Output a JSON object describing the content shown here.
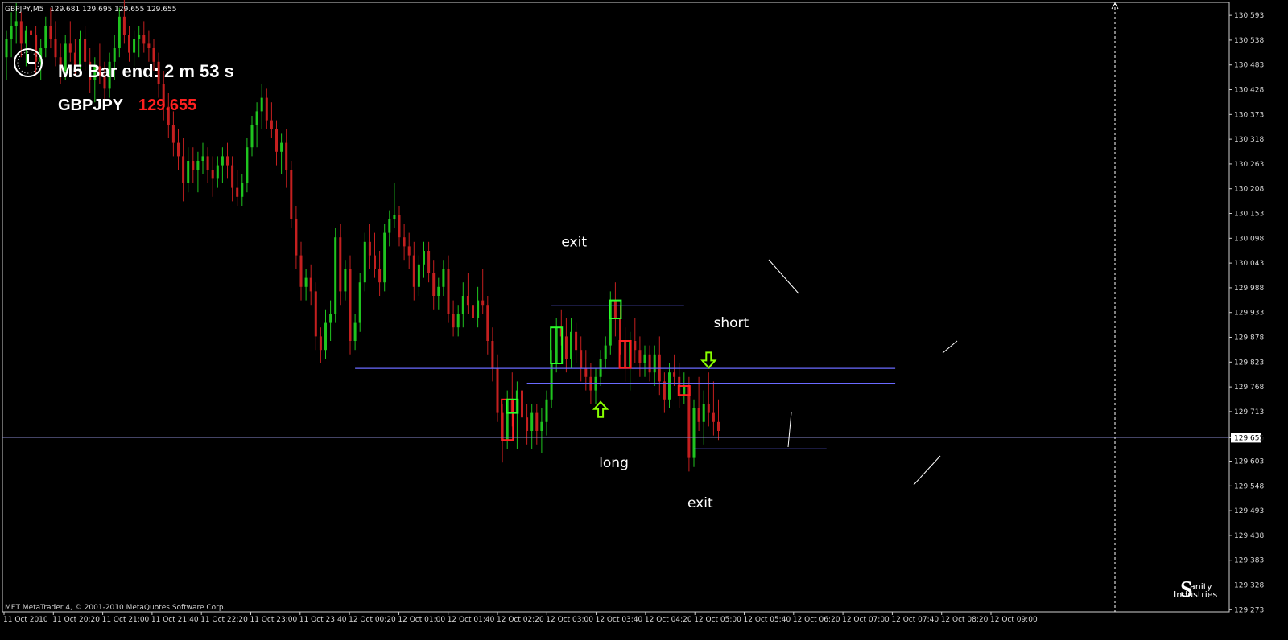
{
  "header": {
    "symbol_timeframe": "GBPJPY,M5",
    "ohlc": "129.681 129.695 129.655 129.655"
  },
  "timer": {
    "label": "M5 Bar end: 2 m 53 s",
    "icon": "clock-icon"
  },
  "quote": {
    "symbol": "GBPJPY",
    "price": "129.655"
  },
  "footer": {
    "copyright": "MET MetaTrader 4, © 2001-2010 MetaQuotes Software Corp.",
    "logo_line1": "anity",
    "logo_line2": "Industries",
    "logo_glyph": "S"
  },
  "colors": {
    "background": "#000000",
    "bull": "#1fc41f",
    "bear": "#c41f1f",
    "level_line": "#6a6aff",
    "highlight_bull": "#2bff2b",
    "highlight_bear": "#ff2020",
    "arrow": "#88ff00",
    "current_price_line": "#8888cc",
    "price_text": "#ff2020"
  },
  "chart_data": {
    "type": "candlestick",
    "title": "GBPJPY,M5",
    "timeframe": "M5",
    "ylim": [
      129.27,
      130.62
    ],
    "y_ticks": [
      "130.593",
      "130.538",
      "130.483",
      "130.428",
      "130.373",
      "130.318",
      "130.263",
      "130.208",
      "130.153",
      "130.098",
      "130.043",
      "129.988",
      "129.933",
      "129.878",
      "129.823",
      "129.768",
      "129.713",
      "129.655",
      "129.603",
      "129.548",
      "129.493",
      "129.438",
      "129.383",
      "129.328",
      "129.273"
    ],
    "x_ticks": [
      "11 Oct 2010",
      "11 Oct 20:20",
      "11 Oct 21:00",
      "11 Oct 21:40",
      "11 Oct 22:20",
      "11 Oct 23:00",
      "11 Oct 23:40",
      "12 Oct 00:20",
      "12 Oct 01:00",
      "12 Oct 01:40",
      "12 Oct 02:20",
      "12 Oct 03:00",
      "12 Oct 03:40",
      "12 Oct 04:20",
      "12 Oct 05:00",
      "12 Oct 05:40",
      "12 Oct 06:20",
      "12 Oct 07:00",
      "12 Oct 07:40",
      "12 Oct 08:20",
      "12 Oct 09:00"
    ],
    "current_price": 129.655,
    "grid": false,
    "candles": [
      [
        130.5,
        130.56,
        130.45,
        130.54
      ],
      [
        130.54,
        130.6,
        130.5,
        130.57
      ],
      [
        130.57,
        130.62,
        130.53,
        130.58
      ],
      [
        130.58,
        130.6,
        130.5,
        130.53
      ],
      [
        130.53,
        130.57,
        130.48,
        130.56
      ],
      [
        130.56,
        130.6,
        130.52,
        130.55
      ],
      [
        130.55,
        130.57,
        130.46,
        130.49
      ],
      [
        130.49,
        130.54,
        130.45,
        130.52
      ],
      [
        130.52,
        130.59,
        130.5,
        130.57
      ],
      [
        130.57,
        130.61,
        130.52,
        130.54
      ],
      [
        130.54,
        130.58,
        130.48,
        130.5
      ],
      [
        130.5,
        130.53,
        130.44,
        130.47
      ],
      [
        130.47,
        130.55,
        130.45,
        130.53
      ],
      [
        130.53,
        130.58,
        130.49,
        130.51
      ],
      [
        130.51,
        130.54,
        130.46,
        130.48
      ],
      [
        130.48,
        130.56,
        130.46,
        130.54
      ],
      [
        130.54,
        130.57,
        130.47,
        130.49
      ],
      [
        130.49,
        130.52,
        130.42,
        130.45
      ],
      [
        130.45,
        130.5,
        130.4,
        130.48
      ],
      [
        130.48,
        130.53,
        130.44,
        130.46
      ],
      [
        130.46,
        130.49,
        130.4,
        130.43
      ],
      [
        130.43,
        130.51,
        130.41,
        130.49
      ],
      [
        130.49,
        130.55,
        130.45,
        130.52
      ],
      [
        130.52,
        130.61,
        130.5,
        130.59
      ],
      [
        130.59,
        130.63,
        130.53,
        130.55
      ],
      [
        130.55,
        130.57,
        130.49,
        130.51
      ],
      [
        130.51,
        130.56,
        130.48,
        130.54
      ],
      [
        130.54,
        130.57,
        130.5,
        130.55
      ],
      [
        130.55,
        130.58,
        130.51,
        130.53
      ],
      [
        130.53,
        130.56,
        130.49,
        130.52
      ],
      [
        130.52,
        130.54,
        130.47,
        130.49
      ],
      [
        130.49,
        130.51,
        130.41,
        130.44
      ],
      [
        130.44,
        130.47,
        130.36,
        130.39
      ],
      [
        130.39,
        130.42,
        130.32,
        130.35
      ],
      [
        130.35,
        130.38,
        130.28,
        130.31
      ],
      [
        130.31,
        130.34,
        130.25,
        130.28
      ],
      [
        130.28,
        130.32,
        130.18,
        130.22
      ],
      [
        130.22,
        130.3,
        130.2,
        130.27
      ],
      [
        130.27,
        130.3,
        130.22,
        130.25
      ],
      [
        130.25,
        130.29,
        130.2,
        130.27
      ],
      [
        130.27,
        130.31,
        130.24,
        130.28
      ],
      [
        130.28,
        130.3,
        130.22,
        130.25
      ],
      [
        130.25,
        130.28,
        130.19,
        130.23
      ],
      [
        130.23,
        130.28,
        130.21,
        130.26
      ],
      [
        130.26,
        130.3,
        130.22,
        130.28
      ],
      [
        130.28,
        130.31,
        130.23,
        130.26
      ],
      [
        130.26,
        130.28,
        130.18,
        130.21
      ],
      [
        130.21,
        130.25,
        130.17,
        130.19
      ],
      [
        130.19,
        130.24,
        130.17,
        130.22
      ],
      [
        130.22,
        130.32,
        130.2,
        130.3
      ],
      [
        130.3,
        130.37,
        130.28,
        130.35
      ],
      [
        130.35,
        130.4,
        130.3,
        130.38
      ],
      [
        130.38,
        130.44,
        130.34,
        130.41
      ],
      [
        130.41,
        130.43,
        130.34,
        130.36
      ],
      [
        130.36,
        130.4,
        130.32,
        130.34
      ],
      [
        130.34,
        130.36,
        130.26,
        130.29
      ],
      [
        130.29,
        130.33,
        130.24,
        130.31
      ],
      [
        130.31,
        130.34,
        130.21,
        130.25
      ],
      [
        130.25,
        130.27,
        130.12,
        130.14
      ],
      [
        130.14,
        130.17,
        130.03,
        130.06
      ],
      [
        130.06,
        130.09,
        129.96,
        129.99
      ],
      [
        129.99,
        130.03,
        129.96,
        130.01
      ],
      [
        130.01,
        130.04,
        129.95,
        129.98
      ],
      [
        129.98,
        130.0,
        129.85,
        129.88
      ],
      [
        129.88,
        129.9,
        129.82,
        129.85
      ],
      [
        129.85,
        129.94,
        129.83,
        129.91
      ],
      [
        129.91,
        129.96,
        129.87,
        129.93
      ],
      [
        129.93,
        130.12,
        129.91,
        130.1
      ],
      [
        130.1,
        130.13,
        129.95,
        129.98
      ],
      [
        129.98,
        130.05,
        129.96,
        130.03
      ],
      [
        130.03,
        130.06,
        129.84,
        129.87
      ],
      [
        129.87,
        129.93,
        129.85,
        129.91
      ],
      [
        129.91,
        130.02,
        129.89,
        130.0
      ],
      [
        130.0,
        130.11,
        129.98,
        130.09
      ],
      [
        130.09,
        130.13,
        130.03,
        130.06
      ],
      [
        130.06,
        130.11,
        130.01,
        130.03
      ],
      [
        130.03,
        130.07,
        129.97,
        130.0
      ],
      [
        130.0,
        130.13,
        129.98,
        130.11
      ],
      [
        130.11,
        130.16,
        130.08,
        130.14
      ],
      [
        130.14,
        130.22,
        130.12,
        130.15
      ],
      [
        130.15,
        130.17,
        130.08,
        130.1
      ],
      [
        130.1,
        130.13,
        130.05,
        130.08
      ],
      [
        130.08,
        130.11,
        130.03,
        130.06
      ],
      [
        130.06,
        130.09,
        129.96,
        129.99
      ],
      [
        129.99,
        130.06,
        129.97,
        130.04
      ],
      [
        130.04,
        130.09,
        130.01,
        130.07
      ],
      [
        130.07,
        130.09,
        130.0,
        130.02
      ],
      [
        130.02,
        130.05,
        129.94,
        129.97
      ],
      [
        129.97,
        130.01,
        129.94,
        129.99
      ],
      [
        129.99,
        130.05,
        129.97,
        130.03
      ],
      [
        130.03,
        130.06,
        129.91,
        129.93
      ],
      [
        129.93,
        129.96,
        129.88,
        129.9
      ],
      [
        129.9,
        129.95,
        129.88,
        129.93
      ],
      [
        129.93,
        130.0,
        129.9,
        129.97
      ],
      [
        129.97,
        130.02,
        129.93,
        129.95
      ],
      [
        129.95,
        129.98,
        129.89,
        129.92
      ],
      [
        129.92,
        129.99,
        129.9,
        129.96
      ],
      [
        129.96,
        130.03,
        129.93,
        129.95
      ],
      [
        129.95,
        129.97,
        129.84,
        129.87
      ],
      [
        129.87,
        129.9,
        129.78,
        129.81
      ],
      [
        129.81,
        129.84,
        129.69,
        129.71
      ],
      [
        129.71,
        129.73,
        129.6,
        129.65
      ],
      [
        129.65,
        129.76,
        129.63,
        129.74
      ],
      [
        129.74,
        129.8,
        129.68,
        129.71
      ],
      [
        129.71,
        129.78,
        129.63,
        129.76
      ],
      [
        129.76,
        129.79,
        129.66,
        129.7
      ],
      [
        129.7,
        129.73,
        129.64,
        129.67
      ],
      [
        129.67,
        129.73,
        129.63,
        129.71
      ],
      [
        129.71,
        129.73,
        129.64,
        129.67
      ],
      [
        129.67,
        129.72,
        129.62,
        129.69
      ],
      [
        129.69,
        129.76,
        129.66,
        129.74
      ],
      [
        129.74,
        129.85,
        129.72,
        129.82
      ],
      [
        129.82,
        129.92,
        129.8,
        129.9
      ],
      [
        129.9,
        129.94,
        129.86,
        129.88
      ],
      [
        129.88,
        129.92,
        129.8,
        129.83
      ],
      [
        129.83,
        129.92,
        129.81,
        129.89
      ],
      [
        129.89,
        129.91,
        129.82,
        129.85
      ],
      [
        129.85,
        129.88,
        129.78,
        129.81
      ],
      [
        129.81,
        129.85,
        129.76,
        129.79
      ],
      [
        129.79,
        129.82,
        129.73,
        129.76
      ],
      [
        129.76,
        129.81,
        129.73,
        129.79
      ],
      [
        129.79,
        129.85,
        129.77,
        129.83
      ],
      [
        129.83,
        129.88,
        129.81,
        129.86
      ],
      [
        129.86,
        129.98,
        129.84,
        129.96
      ],
      [
        129.96,
        130.0,
        129.88,
        129.92
      ],
      [
        129.92,
        129.95,
        129.84,
        129.87
      ],
      [
        129.87,
        129.9,
        129.78,
        129.81
      ],
      [
        129.81,
        129.89,
        129.76,
        129.87
      ],
      [
        129.87,
        129.92,
        129.82,
        129.85
      ],
      [
        129.85,
        129.88,
        129.79,
        129.82
      ],
      [
        129.82,
        129.86,
        129.79,
        129.84
      ],
      [
        129.84,
        129.86,
        129.78,
        129.8
      ],
      [
        129.8,
        129.86,
        129.77,
        129.84
      ],
      [
        129.84,
        129.88,
        129.75,
        129.78
      ],
      [
        129.78,
        129.8,
        129.71,
        129.74
      ],
      [
        129.74,
        129.82,
        129.72,
        129.8
      ],
      [
        129.8,
        129.84,
        129.77,
        129.79
      ],
      [
        129.79,
        129.82,
        129.72,
        129.75
      ],
      [
        129.75,
        129.8,
        129.73,
        129.77
      ],
      [
        129.77,
        129.79,
        129.58,
        129.61
      ],
      [
        129.61,
        129.74,
        129.59,
        129.72
      ],
      [
        129.72,
        129.79,
        129.67,
        129.69
      ],
      [
        129.69,
        129.76,
        129.64,
        129.73
      ],
      [
        129.73,
        129.8,
        129.68,
        129.71
      ],
      [
        129.71,
        129.78,
        129.66,
        129.69
      ],
      [
        129.69,
        129.74,
        129.65,
        129.67
      ]
    ],
    "highlighted_candles": [
      {
        "index": 102,
        "color": "bear"
      },
      {
        "index": 103,
        "color": "bull"
      },
      {
        "index": 112,
        "color": "bull"
      },
      {
        "index": 124,
        "color": "bull"
      },
      {
        "index": 126,
        "color": "bear"
      },
      {
        "index": 138,
        "color": "bear"
      }
    ],
    "level_lines": [
      {
        "price": 129.948,
        "from": 111,
        "to": 138
      },
      {
        "price": 129.809,
        "from": 71,
        "to": 181
      },
      {
        "price": 129.776,
        "from": 106,
        "to": 181
      },
      {
        "price": 129.63,
        "from": 140,
        "to": 167
      }
    ],
    "annotations": [
      {
        "text": "exit",
        "price": 130.08,
        "index": 114
      },
      {
        "text": "short",
        "price": 129.9,
        "index": 145
      },
      {
        "text": "long",
        "price": 129.59,
        "index": 122
      },
      {
        "text": "exit",
        "price": 129.5,
        "index": 140
      }
    ],
    "arrows": [
      {
        "direction": "up",
        "price": 129.715,
        "index": 121
      },
      {
        "direction": "down",
        "price": 129.83,
        "index": 143
      }
    ]
  }
}
